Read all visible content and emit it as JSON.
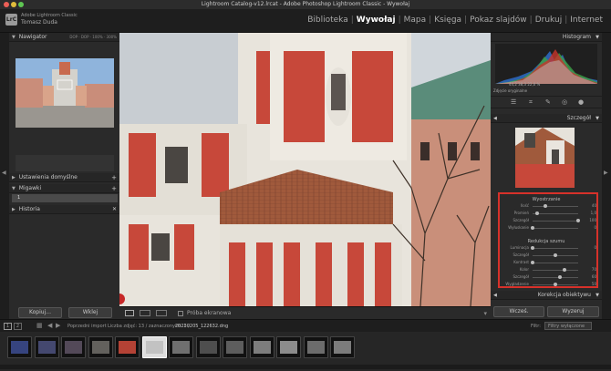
{
  "window": {
    "title": "Lightroom Catalog-v12.lrcat - Adobe Photoshop Lightroom Classic - Wywołaj"
  },
  "identity": {
    "line1": "Adobe Lightroom Classic",
    "line2": "Tomasz Duda",
    "logo": "LrC"
  },
  "modules": [
    "Biblioteka",
    "Wywołaj",
    "Mapa",
    "Księga",
    "Pokaz slajdów",
    "Drukuj",
    "Internet"
  ],
  "active_module": "Wywołaj",
  "left": {
    "navigator": "Nawigator",
    "nav_opts": "DOP  ·  DOP  ·  100%  ·  300%",
    "presets": "Ustawienia domyślne",
    "snapshots": "Migawki",
    "snapshot_item": "1",
    "history": "Historia",
    "copy": "Kopiuj...",
    "paste": "Wklej"
  },
  "right": {
    "histogram": "Histogram",
    "hist_vals": "44,2   38,3   22,0 %",
    "original_photo": "Zdjęcie oryginalne",
    "detail": "Szczegół",
    "sharpen_title": "Wyostrzanie",
    "sharpen": [
      {
        "label": "Ilość",
        "value": "40",
        "frac": 0.27
      },
      {
        "label": "Promień",
        "value": "1,0",
        "frac": 0.1
      },
      {
        "label": "Szczegół",
        "value": "100",
        "frac": 1.0
      },
      {
        "label": "Wyłuskanie",
        "value": "0",
        "frac": 0.0
      }
    ],
    "noise_title": "Redukcja szumu",
    "noise": [
      {
        "label": "Luminacja",
        "value": "0",
        "frac": 0.0
      },
      {
        "label": "Szczegół",
        "value": "",
        "frac": 0.5
      },
      {
        "label": "Kontrast",
        "value": "",
        "frac": 0.0
      },
      {
        "label": "Kolor",
        "value": "70",
        "frac": 0.7
      },
      {
        "label": "Szczegół",
        "value": "60",
        "frac": 0.6
      },
      {
        "label": "Wygładzenie",
        "value": "50",
        "frac": 0.5
      }
    ],
    "lens": "Korekcja obiektywu",
    "previous": "Wcześ.",
    "reset": "Wyzeruj"
  },
  "toolbar": {
    "softproof": "Próba ekranowa"
  },
  "bottom": {
    "pages": [
      "1",
      "2"
    ],
    "source": "Poprzedni import",
    "count": "Liczba zdjęć: 13 / zaznaczonych: 1 /",
    "filename": "20230205_122632.dng",
    "filter_label": "Filtr:",
    "filter_value": "Filtry wyłączone"
  },
  "colors": {
    "accent": "#d7312a",
    "panel": "#2a2a2a",
    "active_text": "#ffffff"
  }
}
